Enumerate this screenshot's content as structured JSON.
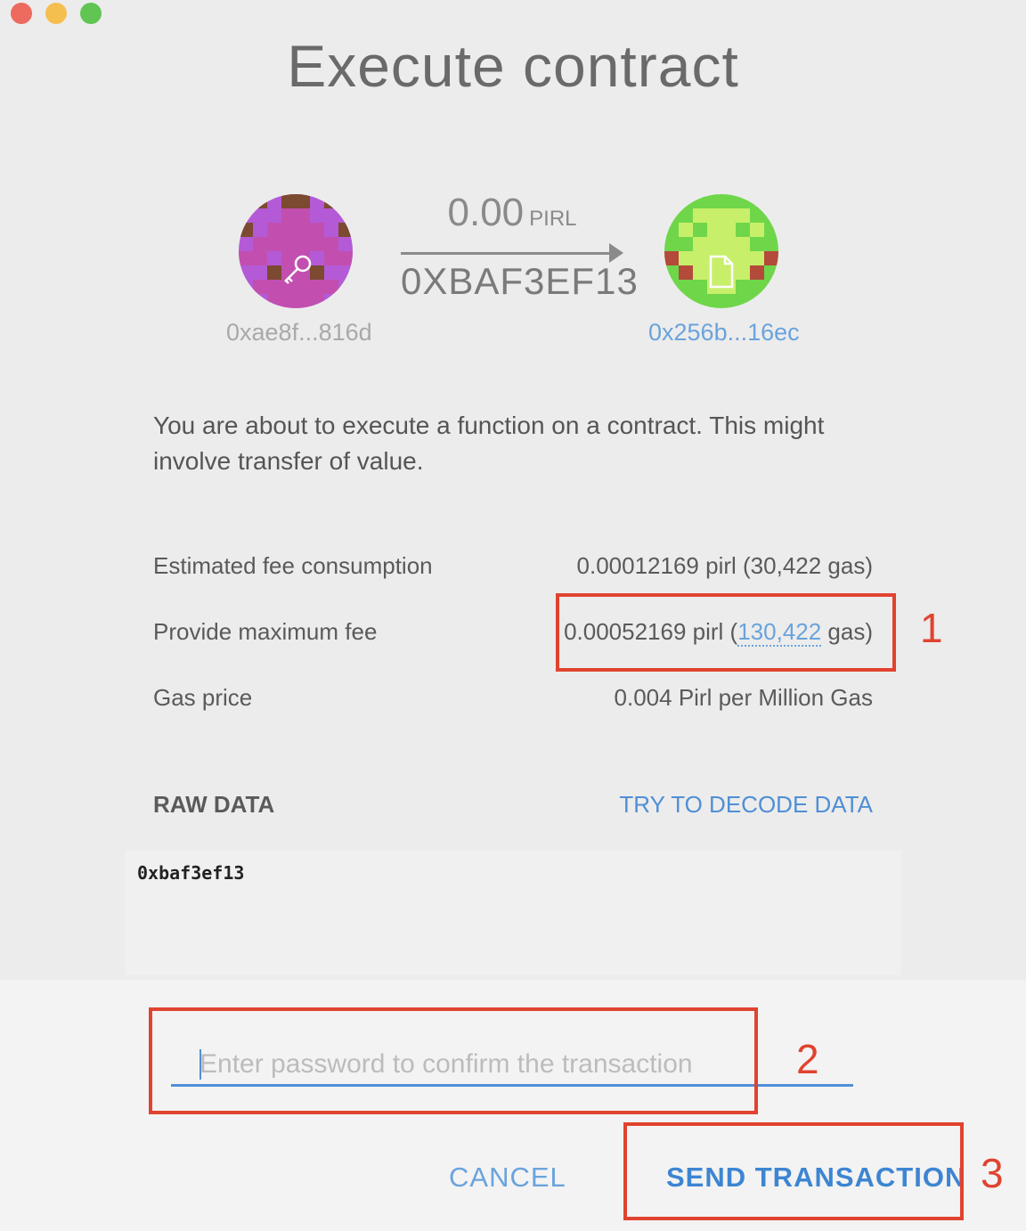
{
  "window": {
    "title": "Execute contract"
  },
  "transfer": {
    "amount": "0.00",
    "unit": "PIRL",
    "function_name": "0XBAF3EF13",
    "from_address": "0xae8f...816d",
    "to_address": "0x256b...16ec",
    "from_icon": "key-icon",
    "to_icon": "document-icon",
    "from_avatar_colors": [
      "#b45ad6",
      "#c24fb0",
      "#7b4a30"
    ],
    "to_avatar_colors": [
      "#6fd64a",
      "#c8ef6a",
      "#b34a3a"
    ]
  },
  "description": "You are about to execute a function on a contract. This might involve transfer of value.",
  "fees": {
    "estimated_label": "Estimated fee consumption",
    "estimated_value": "0.00012169 pirl (30,422 gas)",
    "max_label": "Provide maximum fee",
    "max_value_prefix": "0.00052169 pirl (",
    "max_gas": "130,422",
    "max_value_suffix": " gas)",
    "gas_price_label": "Gas price",
    "gas_price_value": "0.004 Pirl per Million Gas"
  },
  "raw_data": {
    "label": "RAW DATA",
    "decode_link": "TRY TO DECODE DATA",
    "value": "0xbaf3ef13"
  },
  "password": {
    "placeholder": "Enter password to confirm the transaction",
    "value": ""
  },
  "buttons": {
    "cancel": "CANCEL",
    "send": "SEND TRANSACTION"
  },
  "annotations": [
    "1",
    "2",
    "3"
  ],
  "colors": {
    "accent": "#4f8fd6",
    "annotation": "#e0432f"
  }
}
